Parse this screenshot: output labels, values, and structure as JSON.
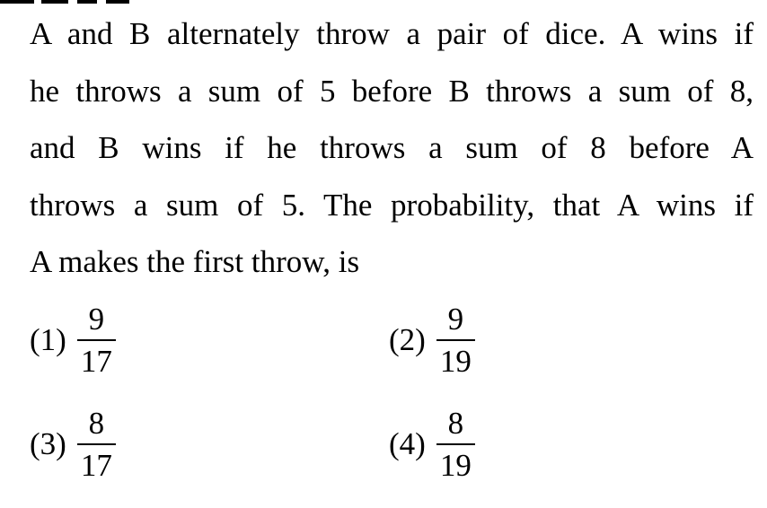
{
  "question": {
    "lines": [
      "A and B alternately throw a pair of dice. A wins if",
      "he throws a sum of 5 before B throws a sum of 8,",
      "and B wins if he throws a sum of 8 before A",
      "throws a sum of 5. The probability, that A wins if",
      "A makes the first throw, is"
    ]
  },
  "options": [
    {
      "label": "(1)",
      "numerator": "9",
      "denominator": "17"
    },
    {
      "label": "(2)",
      "numerator": "9",
      "denominator": "19"
    },
    {
      "label": "(3)",
      "numerator": "8",
      "denominator": "17"
    },
    {
      "label": "(4)",
      "numerator": "8",
      "denominator": "19"
    }
  ]
}
